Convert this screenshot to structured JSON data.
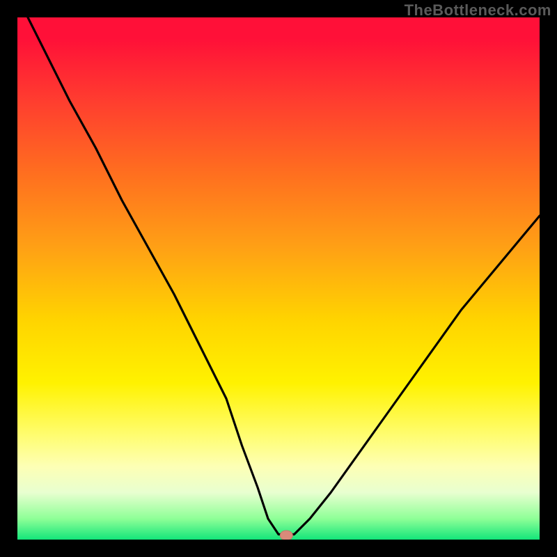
{
  "watermark": "TheBottleneck.com",
  "chart_data": {
    "type": "line",
    "title": "",
    "xlabel": "",
    "ylabel": "",
    "xlim": [
      0,
      100
    ],
    "ylim": [
      0,
      100
    ],
    "grid": false,
    "series": [
      {
        "name": "bottleneck-curve",
        "x": [
          2,
          5,
          10,
          15,
          20,
          25,
          30,
          35,
          40,
          43,
          46,
          48,
          50,
          53,
          56,
          60,
          65,
          70,
          75,
          80,
          85,
          90,
          95,
          100
        ],
        "values": [
          100,
          94,
          84,
          75,
          65,
          56,
          47,
          37,
          27,
          18,
          10,
          4,
          1,
          1,
          4,
          9,
          16,
          23,
          30,
          37,
          44,
          50,
          56,
          62
        ]
      }
    ],
    "markers": [
      {
        "name": "optimal-point",
        "x": 51.5,
        "y": 0.8
      }
    ],
    "gradient_stops": [
      {
        "pos": 0.0,
        "color": "#ff1038"
      },
      {
        "pos": 0.04,
        "color": "#ff1038"
      },
      {
        "pos": 0.16,
        "color": "#ff3d2f"
      },
      {
        "pos": 0.3,
        "color": "#ff6f1f"
      },
      {
        "pos": 0.44,
        "color": "#ffa015"
      },
      {
        "pos": 0.58,
        "color": "#ffd400"
      },
      {
        "pos": 0.7,
        "color": "#fff200"
      },
      {
        "pos": 0.8,
        "color": "#fffd70"
      },
      {
        "pos": 0.86,
        "color": "#fdffb5"
      },
      {
        "pos": 0.91,
        "color": "#e8ffd0"
      },
      {
        "pos": 0.96,
        "color": "#8eff97"
      },
      {
        "pos": 1.0,
        "color": "#13e57a"
      }
    ]
  }
}
